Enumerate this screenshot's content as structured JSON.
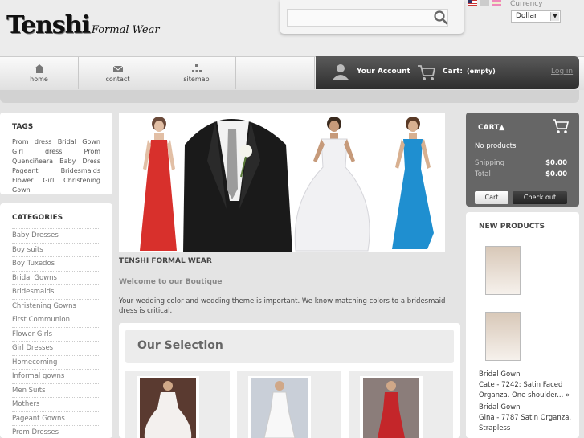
{
  "header": {
    "logo_main": "Tenshi",
    "logo_sub": "Formal Wear",
    "search_placeholder": "",
    "currency_label": "Currency",
    "currency_value": "Dollar"
  },
  "nav": {
    "items": [
      {
        "label": "home",
        "icon": "home-icon"
      },
      {
        "label": "contact",
        "icon": "mail-icon"
      },
      {
        "label": "sitemap",
        "icon": "sitemap-icon"
      }
    ],
    "account_label": "Your Account",
    "cart_label": "Cart:",
    "cart_status": "(empty)",
    "login_label": "Log in"
  },
  "tags": {
    "title": "TAGS",
    "text": "Prom dress  Bridal Gown  Girl dress  Prom  Quenciñeara  Baby  Dress  Pageant  Bridesmaids  Flower  Girl  Christening Gown"
  },
  "categories": {
    "title": "CATEGORIES",
    "items": [
      "Baby Dresses",
      "Boy suits",
      "Boy Tuxedos",
      "Bridal Gowns",
      "Bridesmaids",
      "Christening Gowns",
      "First Communion",
      "Flower Girls",
      "Girl Dresses",
      "Homecoming",
      "Informal gowns",
      "Men Suits",
      "Mothers",
      "Pageant Gowns",
      "Prom Dresses"
    ]
  },
  "main": {
    "title": "TENSHI FORMAL WEAR",
    "welcome": "Welcome to our Boutique",
    "intro": "Your wedding color and wedding theme is important. We know matching colors to a bridesmaid dress is critical.",
    "selection_title": "Our Selection"
  },
  "cart": {
    "title": "CART",
    "no_products": "No products",
    "shipping_label": "Shipping",
    "shipping_value": "$0.00",
    "total_label": "Total",
    "total_value": "$0.00",
    "cart_button": "Cart",
    "checkout_button": "Check out"
  },
  "new_products": {
    "title": "NEW PRODUCTS",
    "item1_line1": "Bridal Gown",
    "item1_line2": "Cate - 7242: Satin Faced Organza. One shoulder... »",
    "item2_line1": "Bridal Gown",
    "item2_line2": "Gina - 7787 Satin Organza. Strapless"
  },
  "colors": {
    "account_bar": "#3a3a3a",
    "cart_panel": "#666666",
    "red_dress": "#d8302c",
    "blue_dress": "#1f8fd0"
  }
}
